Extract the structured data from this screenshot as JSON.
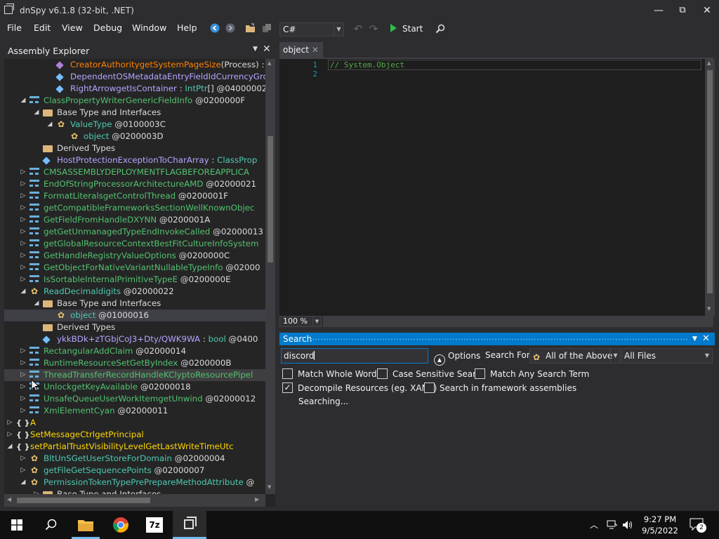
{
  "window": {
    "title": "dnSpy v6.1.8 (32-bit, .NET)",
    "minimize": "—",
    "restore": "⧉",
    "close": "✕"
  },
  "menu": [
    "File",
    "Edit",
    "View",
    "Debug",
    "Window",
    "Help"
  ],
  "toolbar": {
    "language": "C#",
    "start_label": "Start"
  },
  "explorer": {
    "title": "Assembly Explorer",
    "rows": [
      {
        "indent": 4,
        "exp": "",
        "icon": "method",
        "parts": [
          {
            "t": "CreatorAuthoritygetSystemPageSize",
            "c": "c-orange"
          },
          {
            "t": "(Process) : in",
            "c": "c-white"
          }
        ]
      },
      {
        "indent": 4,
        "exp": "",
        "icon": "field",
        "parts": [
          {
            "t": "DependentOSMetadataEntryFieldIdCurrencyGro",
            "c": "c-purple"
          }
        ]
      },
      {
        "indent": 4,
        "exp": "",
        "icon": "field",
        "parts": [
          {
            "t": "RightArrowgetIsContainer",
            "c": "c-purple"
          },
          {
            "t": " : ",
            "c": "c-white"
          },
          {
            "t": "IntPtr",
            "c": "c-green"
          },
          {
            "t": "[] @04000002",
            "c": "c-white"
          }
        ]
      },
      {
        "indent": 2,
        "exp": "◢",
        "icon": "class",
        "parts": [
          {
            "t": "ClassPropertyWriterGenericFieldInfo",
            "c": "c-cls"
          },
          {
            "t": " @0200000F",
            "c": "c-white"
          }
        ]
      },
      {
        "indent": 3,
        "exp": "◢",
        "icon": "folder",
        "parts": [
          {
            "t": "Base Type and Interfaces",
            "c": "c-white"
          }
        ]
      },
      {
        "indent": 4,
        "exp": "◢",
        "icon": "struct",
        "parts": [
          {
            "t": "ValueType",
            "c": "c-green"
          },
          {
            "t": " @0100003C",
            "c": "c-white"
          }
        ]
      },
      {
        "indent": 5,
        "exp": "",
        "icon": "struct",
        "parts": [
          {
            "t": "object",
            "c": "c-green"
          },
          {
            "t": " @0200003D",
            "c": "c-white"
          }
        ]
      },
      {
        "indent": 3,
        "exp": "",
        "icon": "folder",
        "parts": [
          {
            "t": "Derived Types",
            "c": "c-white"
          }
        ]
      },
      {
        "indent": 3,
        "exp": "",
        "icon": "field",
        "parts": [
          {
            "t": "HostProtectionExceptionToCharArray",
            "c": "c-purple"
          },
          {
            "t": " : ",
            "c": "c-white"
          },
          {
            "t": "ClassProp",
            "c": "c-green"
          }
        ]
      },
      {
        "indent": 2,
        "exp": "▷",
        "icon": "class",
        "parts": [
          {
            "t": "CMSASSEMBLYDEPLOYMENTFLAGBEFOREAPPLICA",
            "c": "c-cls"
          }
        ]
      },
      {
        "indent": 2,
        "exp": "▷",
        "icon": "class",
        "parts": [
          {
            "t": "EndOfStringProcessorArchitectureAMD",
            "c": "c-cls"
          },
          {
            "t": " @02000021",
            "c": "c-white"
          }
        ]
      },
      {
        "indent": 2,
        "exp": "▷",
        "icon": "class",
        "parts": [
          {
            "t": "FormatLiteralsgetControlThread",
            "c": "c-cls"
          },
          {
            "t": " @0200001F",
            "c": "c-white"
          }
        ]
      },
      {
        "indent": 2,
        "exp": "▷",
        "icon": "class",
        "parts": [
          {
            "t": "getCompatibleFrameworksSectionWellKnownObjec",
            "c": "c-cls"
          }
        ]
      },
      {
        "indent": 2,
        "exp": "▷",
        "icon": "class",
        "parts": [
          {
            "t": "GetFieldFromHandleDXYNN",
            "c": "c-cls"
          },
          {
            "t": " @0200001A",
            "c": "c-white"
          }
        ]
      },
      {
        "indent": 2,
        "exp": "▷",
        "icon": "class",
        "parts": [
          {
            "t": "getGetUnmanagedTypeEndInvokeCalled",
            "c": "c-cls"
          },
          {
            "t": " @02000013",
            "c": "c-white"
          }
        ]
      },
      {
        "indent": 2,
        "exp": "▷",
        "icon": "class",
        "parts": [
          {
            "t": "getGlobalResourceContextBestFitCultureInfoSystem",
            "c": "c-cls"
          }
        ]
      },
      {
        "indent": 2,
        "exp": "▷",
        "icon": "class",
        "parts": [
          {
            "t": "GetHandleRegistryValueOptions",
            "c": "c-cls"
          },
          {
            "t": " @0200000C",
            "c": "c-white"
          }
        ]
      },
      {
        "indent": 2,
        "exp": "▷",
        "icon": "class",
        "parts": [
          {
            "t": "GetObjectForNativeVariantNullableTypeInfo",
            "c": "c-cls"
          },
          {
            "t": " @02000",
            "c": "c-white"
          }
        ]
      },
      {
        "indent": 2,
        "exp": "▷",
        "icon": "class",
        "parts": [
          {
            "t": "IsSortableInternalPrimitiveTypeE",
            "c": "c-cls"
          },
          {
            "t": " @0200000E",
            "c": "c-white"
          }
        ]
      },
      {
        "indent": 2,
        "exp": "◢",
        "icon": "struct",
        "parts": [
          {
            "t": "ReadDecimaldigits",
            "c": "c-green"
          },
          {
            "t": " @02000022",
            "c": "c-white"
          }
        ]
      },
      {
        "indent": 3,
        "exp": "◢",
        "icon": "folder",
        "parts": [
          {
            "t": "Base Type and Interfaces",
            "c": "c-white"
          }
        ]
      },
      {
        "indent": 4,
        "exp": "",
        "icon": "struct",
        "sel": true,
        "parts": [
          {
            "t": "object",
            "c": "c-green"
          },
          {
            "t": " @01000016",
            "c": "c-white"
          }
        ]
      },
      {
        "indent": 3,
        "exp": "",
        "icon": "folder",
        "parts": [
          {
            "t": "Derived Types",
            "c": "c-white"
          }
        ]
      },
      {
        "indent": 3,
        "exp": "",
        "icon": "field",
        "parts": [
          {
            "t": "ykkBDk+zTGbjCoJ3+Dty/QWK9WA",
            "c": "c-purple"
          },
          {
            "t": " : ",
            "c": "c-white"
          },
          {
            "t": "bool",
            "c": "c-green"
          },
          {
            "t": " @0400",
            "c": "c-white"
          }
        ]
      },
      {
        "indent": 2,
        "exp": "▷",
        "icon": "class",
        "parts": [
          {
            "t": "RectangularAddClaim",
            "c": "c-cls"
          },
          {
            "t": " @02000014",
            "c": "c-white"
          }
        ]
      },
      {
        "indent": 2,
        "exp": "▷",
        "icon": "class",
        "parts": [
          {
            "t": "RuntimeResourceSetGetByIndex",
            "c": "c-cls"
          },
          {
            "t": " @0200000B",
            "c": "c-white"
          }
        ]
      },
      {
        "indent": 2,
        "exp": "▷",
        "icon": "class",
        "hl": true,
        "parts": [
          {
            "t": "ThreadTransferRecordHandleKClyptoResourcePipel",
            "c": "c-cls"
          }
        ]
      },
      {
        "indent": 2,
        "exp": "▷",
        "icon": "class",
        "parts": [
          {
            "t": "UnlockgetKeyAvailable",
            "c": "c-cls"
          },
          {
            "t": " @02000018",
            "c": "c-white"
          }
        ]
      },
      {
        "indent": 2,
        "exp": "▷",
        "icon": "class",
        "parts": [
          {
            "t": "UnsafeQueueUserWorkItemgetUnwind",
            "c": "c-cls"
          },
          {
            "t": " @02000012",
            "c": "c-white"
          }
        ]
      },
      {
        "indent": 2,
        "exp": "▷",
        "icon": "class",
        "parts": [
          {
            "t": "XmlElementCyan",
            "c": "c-cls"
          },
          {
            "t": " @02000011",
            "c": "c-white"
          }
        ]
      },
      {
        "indent": 1,
        "exp": "▷",
        "icon": "ns",
        "parts": [
          {
            "t": "A",
            "c": "c-yellow"
          }
        ]
      },
      {
        "indent": 1,
        "exp": "▷",
        "icon": "ns",
        "parts": [
          {
            "t": "SetMessageCtrlgetPrincipal",
            "c": "c-yellow"
          }
        ]
      },
      {
        "indent": 1,
        "exp": "◢",
        "icon": "ns",
        "parts": [
          {
            "t": "setPartialTrustVisibilityLevelGetLastWriteTimeUtc",
            "c": "c-yellow"
          }
        ]
      },
      {
        "indent": 2,
        "exp": "▷",
        "icon": "struct",
        "parts": [
          {
            "t": "BltUnSGetUserStoreForDomain",
            "c": "c-green"
          },
          {
            "t": " @02000004",
            "c": "c-white"
          }
        ]
      },
      {
        "indent": 2,
        "exp": "▷",
        "icon": "struct",
        "parts": [
          {
            "t": "getFileGetSequencePoints",
            "c": "c-green"
          },
          {
            "t": " @02000007",
            "c": "c-white"
          }
        ]
      },
      {
        "indent": 2,
        "exp": "◢",
        "icon": "struct",
        "parts": [
          {
            "t": "PermissionTokenTypePrePrepareMethodAttribute",
            "c": "c-green"
          },
          {
            "t": " @",
            "c": "c-white"
          }
        ]
      },
      {
        "indent": 3,
        "exp": "▷",
        "icon": "folder",
        "parts": [
          {
            "t": "Base Type and Interfaces",
            "c": "c-white"
          }
        ]
      }
    ]
  },
  "editor": {
    "tab_label": "object",
    "line_numbers": [
      "1",
      "2"
    ],
    "code_line": "// System.Object",
    "zoom": "100 %"
  },
  "search": {
    "title": "Search",
    "query": "discord",
    "options_label": "Options",
    "search_for_label": "Search For:",
    "search_for_value": "All of the Above",
    "scope_value": "All Files",
    "checkboxes": [
      {
        "label": "Match Whole Words",
        "checked": false
      },
      {
        "label": "Case Sensitive Search",
        "checked": false
      },
      {
        "label": "Match Any Search Term",
        "checked": false
      },
      {
        "label": "Decompile Resources (eg. XAML)",
        "checked": true
      },
      {
        "label": "Search in framework assemblies",
        "checked": false
      }
    ],
    "status": "Searching..."
  },
  "taskbar": {
    "time": "9:27 PM",
    "date": "9/5/2022",
    "notification_count": "2",
    "apps": [
      "file-explorer",
      "chrome",
      "7zip",
      "dnspy"
    ],
    "seven_zip_label": "7z"
  }
}
